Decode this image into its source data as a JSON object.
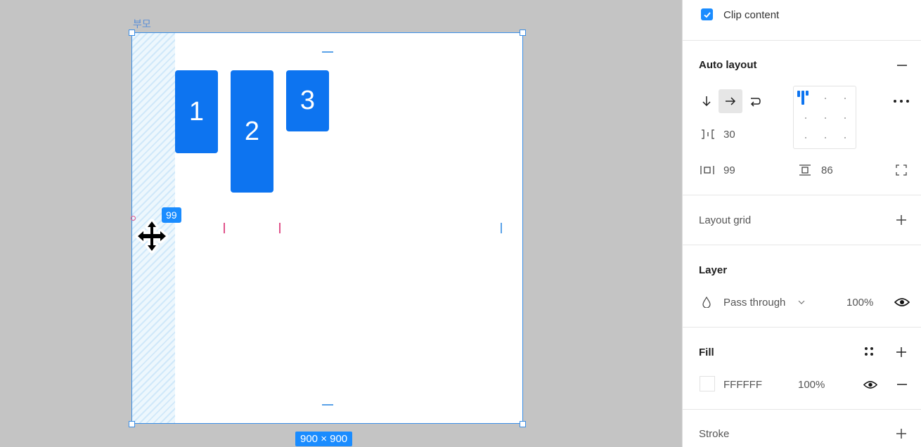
{
  "canvas": {
    "frame_name": "부모",
    "children": [
      "1",
      "2",
      "3"
    ],
    "padding_badge": "99",
    "size_badge": "900 × 900",
    "accent": "#0d74f0",
    "selection_color": "#3a8ee6"
  },
  "panel": {
    "clip_content": {
      "label": "Clip content",
      "checked": true
    },
    "auto_layout": {
      "title": "Auto layout",
      "direction": "horizontal",
      "spacing": "30",
      "padding_horizontal": "99",
      "padding_vertical": "86"
    },
    "layout_grid": {
      "title": "Layout grid"
    },
    "layer": {
      "title": "Layer",
      "blend_mode": "Pass through",
      "opacity": "100%"
    },
    "fill": {
      "title": "Fill",
      "color": "FFFFFF",
      "opacity": "100%"
    },
    "stroke": {
      "title": "Stroke"
    }
  },
  "icons": [
    "down-arrow-icon",
    "right-arrow-icon",
    "wrap-icon",
    "more-icon",
    "spacing-icon",
    "padding-horizontal-icon",
    "padding-vertical-icon",
    "independent-padding-icon",
    "plus-icon",
    "minus-icon",
    "eye-icon",
    "blend-drop-icon",
    "chevron-down-icon",
    "style-grid-icon",
    "check-icon",
    "move-cursor-icon"
  ]
}
